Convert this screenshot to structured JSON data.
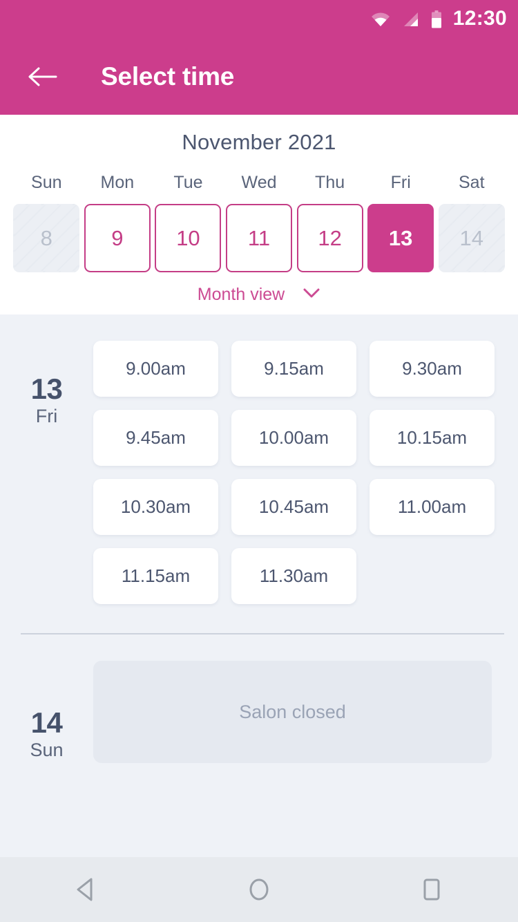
{
  "statusbar": {
    "clock": "12:30",
    "icons": [
      "wifi-icon",
      "cellular-signal-icon",
      "battery-icon"
    ]
  },
  "appbar": {
    "back_icon": "back-arrow-icon",
    "title": "Select time",
    "background_color": "#cc3d8c"
  },
  "calendar": {
    "month_title": "November 2021",
    "weekdays": [
      "Sun",
      "Mon",
      "Tue",
      "Wed",
      "Thu",
      "Fri",
      "Sat"
    ],
    "days": [
      {
        "num": "8",
        "state": "disabled"
      },
      {
        "num": "9",
        "state": "available"
      },
      {
        "num": "10",
        "state": "available"
      },
      {
        "num": "11",
        "state": "available"
      },
      {
        "num": "12",
        "state": "available"
      },
      {
        "num": "13",
        "state": "selected"
      },
      {
        "num": "14",
        "state": "disabled"
      }
    ],
    "month_view_label": "Month view",
    "month_view_icon": "chevron-down-icon",
    "accent_color": "#cc3d8c"
  },
  "sections": [
    {
      "day_num": "13",
      "day_dow": "Fri",
      "slots": [
        "9.00am",
        "9.15am",
        "9.30am",
        "9.45am",
        "10.00am",
        "10.15am",
        "10.30am",
        "10.45am",
        "11.00am",
        "11.15am",
        "11.30am"
      ]
    },
    {
      "day_num": "14",
      "day_dow": "Sun",
      "closed_text": "Salon closed"
    }
  ],
  "navbar": {
    "back_icon": "nav-back-icon",
    "home_icon": "nav-home-icon",
    "recents_icon": "nav-recents-icon"
  }
}
